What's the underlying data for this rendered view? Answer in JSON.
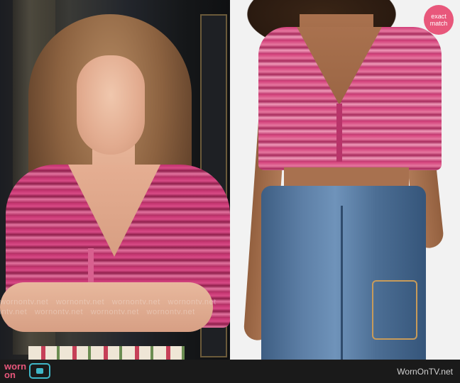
{
  "badge": {
    "line1": "exact",
    "line2": "match"
  },
  "watermark": "wornontv.net",
  "footer": {
    "logo_line1": "worn",
    "logo_line2": "on",
    "site": "WornOnTV.net"
  }
}
